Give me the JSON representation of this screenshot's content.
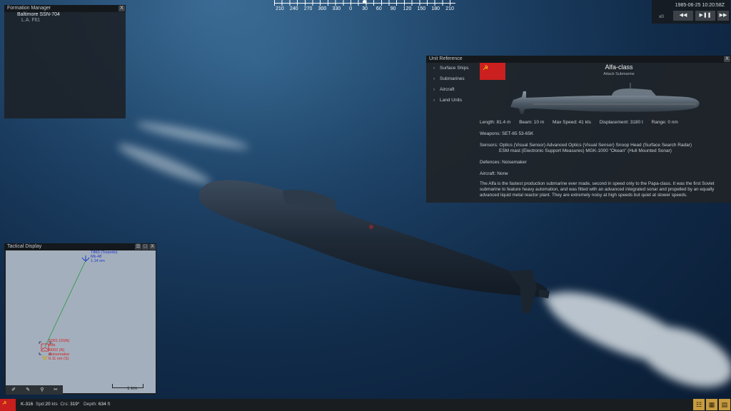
{
  "compass": {
    "labels": [
      "210",
      "240",
      "270",
      "300",
      "330",
      "0",
      "30",
      "60",
      "90",
      "120",
      "150",
      "180",
      "210"
    ]
  },
  "time": {
    "datetime": "1985-06-25 10:20:58Z",
    "speed": "x0",
    "buttons": [
      "◀◀",
      "▶❚❚",
      "▶▶"
    ]
  },
  "formation_manager": {
    "title": "Formation Manager",
    "close": "X",
    "unit": "Baltimore SSN-704",
    "group": "L.A. Flt1"
  },
  "unit_reference": {
    "title": "Unit Reference",
    "close": "X",
    "categories": [
      "Surface Ships",
      "Submarines",
      "Aircraft",
      "Land Units"
    ],
    "flag_emblem": "☭",
    "name": "Alfa-class",
    "type": "Attack Submarine",
    "stats": {
      "length": "Length: 81.4 m",
      "beam": "Beam: 10 m",
      "max_speed": "Max Speed: 41 kts",
      "displacement": "Displacement: 3180 t",
      "range": "Range: 0 nm"
    },
    "weapons": "Weapons:  SET-65  53-65K",
    "sensors_1": "Sensors:  Optics (Visual Sensor)  Advanced Optics (Visual Sensor)  Snoop Head (Surface Search Radar)",
    "sensors_2": "ESM mast (Electronic Support Measures)  MGK-1000 \"Okean\" (Hull Mounted Sonar)",
    "defences": "Defences:  Noisemaker",
    "aircraft": "Aircraft:  None",
    "description": "The Alfa is the fastest production submarine ever made, second in speed only to the Papa-class. It was the first Soviet submarine to feature heavy automation, and was fitted with an advanced integrated sonar and propelled by an equally advanced liquid metal reactor plant. They are extremely noisy at high speeds but quiet at slower speeds."
  },
  "tactical_display": {
    "title": "Tactical Display",
    "menu": "☰",
    "maximize": "□",
    "close": "X",
    "torpedo_label_1": "T860 (Torpedo)",
    "torpedo_label_2": "Mk-48",
    "torpedo_label_3": "1.14 nm",
    "alfa_label_1": "S001 (SSN)",
    "alfa_label_2": "Alfa",
    "nm_label_1": "N002 (N)",
    "nm_label_2": "Noisemaker",
    "nm_label_3": "0.11 nm (S)",
    "scale": "1 km",
    "tools": [
      "✐",
      "✎",
      "⚲",
      "✂"
    ]
  },
  "status": {
    "flag_emblem": "☭",
    "unit": "K-316",
    "speed_label": "Spd:",
    "speed": "20",
    "speed_unit": "kts",
    "course_label": "Crs:",
    "course": "319°",
    "depth_label": "Depth:",
    "depth": "634",
    "depth_unit": "ft",
    "buttons": [
      "☷",
      "▦",
      "▤"
    ]
  }
}
